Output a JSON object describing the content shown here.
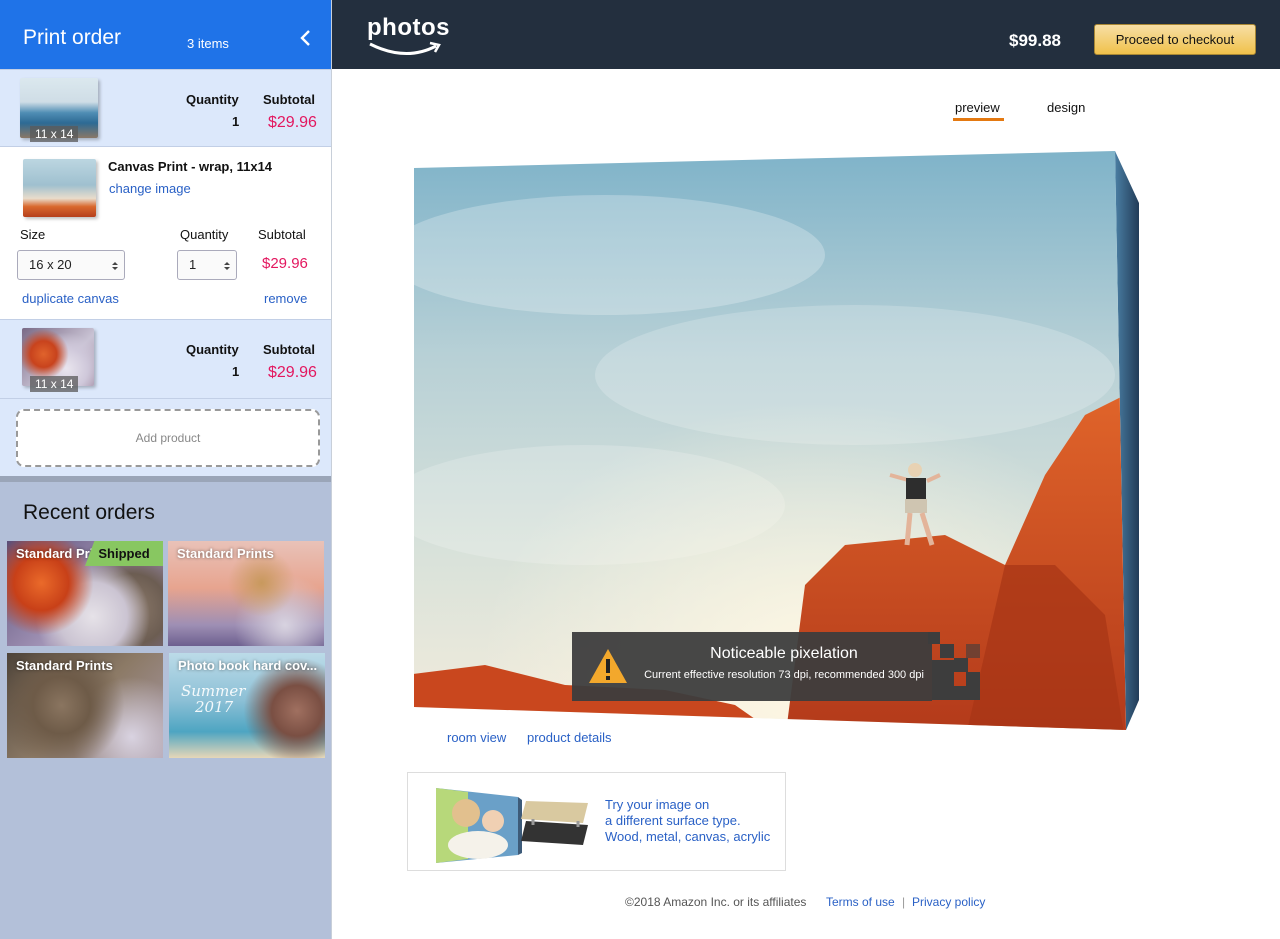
{
  "sidebar": {
    "title": "Print order",
    "item_count": "3 items",
    "items": [
      {
        "size_tag": "11 x 14",
        "quantity_label": "Quantity",
        "quantity": "1",
        "subtotal_label": "Subtotal",
        "subtotal": "$29.96"
      },
      {
        "name": "Canvas Print - wrap, 11x14",
        "change_image": "change image",
        "size_label": "Size",
        "size_value": "16 x 20",
        "quantity_label": "Quantity",
        "quantity": "1",
        "subtotal_label": "Subtotal",
        "subtotal": "$29.96",
        "duplicate": "duplicate canvas",
        "remove": "remove"
      },
      {
        "size_tag": "11 x 14",
        "quantity_label": "Quantity",
        "quantity": "1",
        "subtotal_label": "Subtotal",
        "subtotal": "$29.96"
      }
    ],
    "add_product": "Add product",
    "recent_title": "Recent orders",
    "recent_orders": [
      {
        "label": "Standard Pri",
        "badge": "Shipped"
      },
      {
        "label": "Standard Prints"
      },
      {
        "label": "Standard Prints"
      },
      {
        "label": "Photo book hard cov...",
        "script_line1": "Summer",
        "script_line2": "2017"
      }
    ]
  },
  "topbar": {
    "logo": "photos",
    "total": "$99.88",
    "checkout": "Proceed to checkout"
  },
  "tabs": {
    "preview": "preview",
    "design": "design"
  },
  "warning": {
    "title": "Noticeable pixelation",
    "subtitle": "Current effective resolution 73 dpi, recommended 300 dpi"
  },
  "links": {
    "room_view": "room view",
    "product_details": "product details"
  },
  "surface": {
    "line1": "Try your image on",
    "line2": "a different surface type.",
    "line3": "Wood, metal, canvas, acrylic"
  },
  "footer": {
    "copyright": "©2018 Amazon Inc. or its affiliates",
    "terms": "Terms of use",
    "separator": "|",
    "privacy": "Privacy policy"
  },
  "colors": {
    "sidebar_header": "#1f73e8",
    "topbar": "#232f3e",
    "price": "#e3175f",
    "link": "#2a61c6",
    "checkout": "#f0c14b",
    "tab_accent": "#e47911"
  }
}
